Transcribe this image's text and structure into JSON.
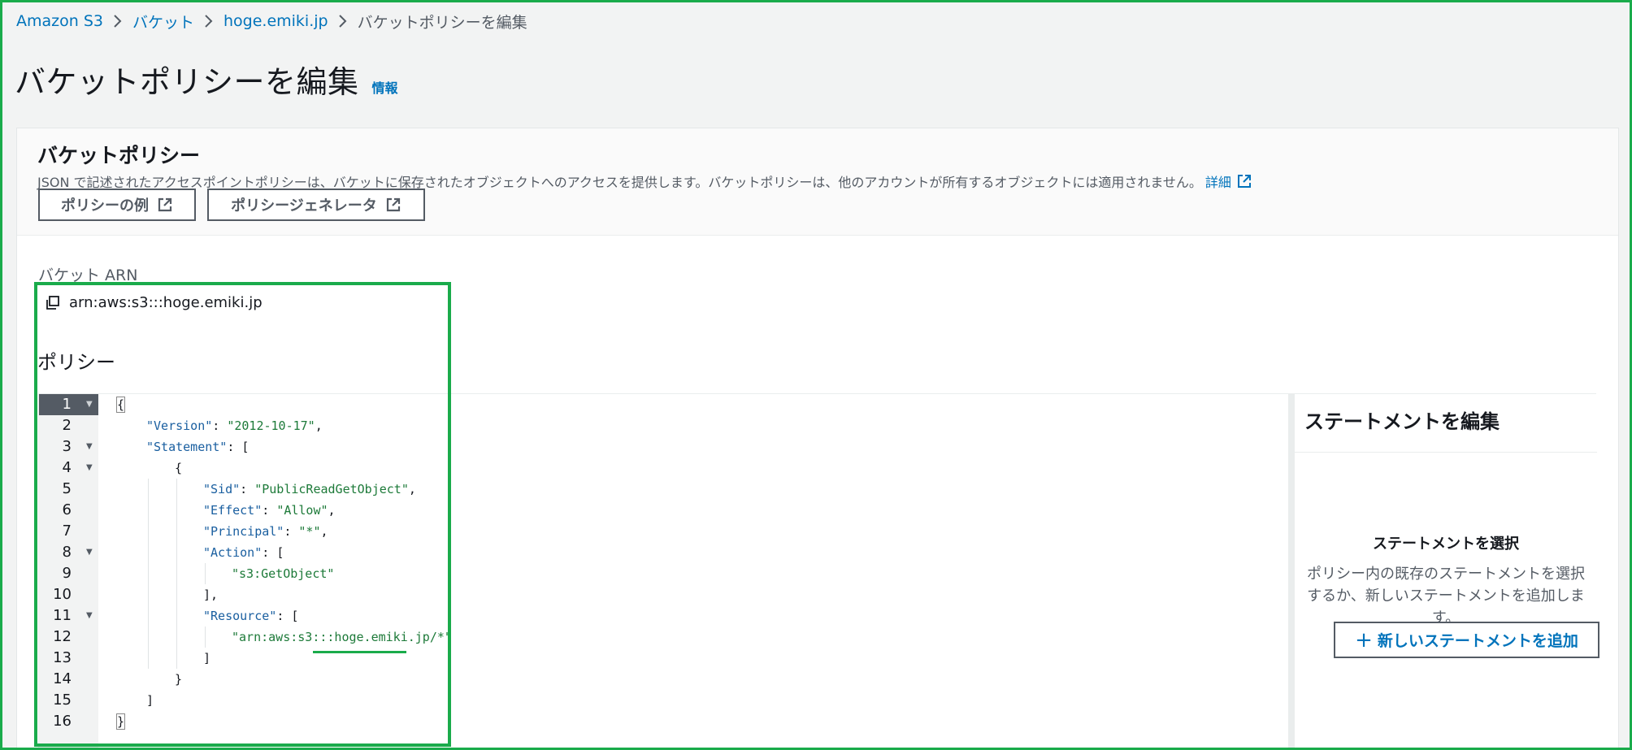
{
  "breadcrumb": {
    "items": [
      "Amazon S3",
      "バケット",
      "hoge.emiki.jp"
    ],
    "current": "バケットポリシーを編集"
  },
  "page": {
    "title": "バケットポリシーを編集",
    "info_link": "情報"
  },
  "panel": {
    "title": "バケットポリシー",
    "description": "JSON で記述されたアクセスポイントポリシーは、バケットに保存されたオブジェクトへのアクセスを提供します。バケットポリシーは、他のアカウントが所有するオブジェクトには適用されません。",
    "detail_link": "詳細",
    "buttons": {
      "example": "ポリシーの例",
      "generator": "ポリシージェネレータ"
    }
  },
  "arn": {
    "label": "バケット ARN",
    "value": "arn:aws:s3:::hoge.emiki.jp"
  },
  "policy": {
    "label": "ポリシー",
    "line_numbers": [
      "1",
      "2",
      "3",
      "4",
      "5",
      "6",
      "7",
      "8",
      "9",
      "10",
      "11",
      "12",
      "13",
      "14",
      "15",
      "16"
    ],
    "lines": {
      "l1": "{",
      "l2_key": "\"Version\"",
      "l2_val": "\"2012-10-17\"",
      "l3_key": "\"Statement\"",
      "l3_open": "[",
      "l4": "{",
      "l5_key": "\"Sid\"",
      "l5_val": "\"PublicReadGetObject\"",
      "l6_key": "\"Effect\"",
      "l6_val": "\"Allow\"",
      "l7_key": "\"Principal\"",
      "l7_val": "\"*\"",
      "l8_key": "\"Action\"",
      "l8_open": "[",
      "l9_val": "\"s3:GetObject\"",
      "l10": "],",
      "l11_key": "\"Resource\"",
      "l11_open": "[",
      "l12_val": "\"arn:aws:s3:::hoge.emiki.jp/*\"",
      "l13": "]",
      "l14": "}",
      "l15": "]",
      "l16": "}"
    }
  },
  "statement_panel": {
    "title": "ステートメントを編集",
    "subtitle": "ステートメントを選択",
    "description": "ポリシー内の既存のステートメントを選択するか、新しいステートメントを追加します。",
    "add_button": "新しいステートメントを追加"
  },
  "colors": {
    "link": "#0073bb",
    "json_key": "#1a5fa0",
    "json_string": "#1d7a39",
    "highlight": "#1aab4b"
  }
}
